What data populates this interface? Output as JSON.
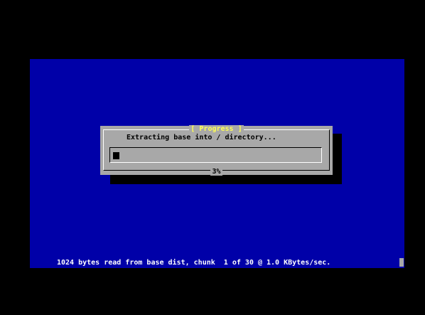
{
  "colors": {
    "background": "#000000",
    "console": "#0000a8",
    "dialog": "#a8a8a8",
    "title": "#ffff55",
    "status_text": "#ffffff"
  },
  "dialog": {
    "title": "[ Progress ]",
    "message": "Extracting base into / directory...",
    "progress_percent": 3,
    "progress_label": "3%"
  },
  "status_line": "1024 bytes read from base dist, chunk  1 of 30 @ 1.0 KBytes/sec.",
  "cursor_icon": "block-cursor-icon"
}
